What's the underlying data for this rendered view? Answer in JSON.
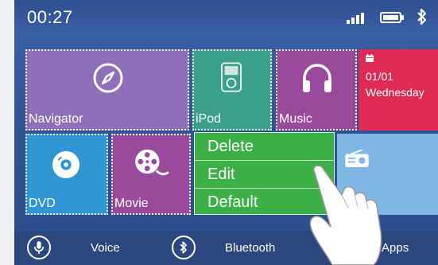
{
  "status_bar": {
    "time": "00:27",
    "icons": [
      "signal-icon",
      "battery-icon",
      "bluetooth-icon"
    ]
  },
  "tiles": {
    "navigator": {
      "label": "Navigator",
      "icon": "compass-icon",
      "color": "#8e6fb8"
    },
    "ipod": {
      "label": "iPod",
      "icon": "ipod-icon",
      "color": "#3aa089"
    },
    "music": {
      "label": "Music",
      "icon": "headphones-icon",
      "color": "#9a4a9c"
    },
    "calendar": {
      "date": "01/01",
      "day": "Wednesday",
      "icon": "calendar-icon",
      "color": "#df2a54"
    },
    "dvd": {
      "label": "DVD",
      "icon": "disc-icon",
      "color": "#2f95d3"
    },
    "movie": {
      "label": "Movie",
      "icon": "film-reel-icon",
      "color": "#9a4a9c"
    },
    "radio": {
      "icon": "radio-icon",
      "color": "#7fb6e3"
    }
  },
  "context_menu": {
    "items": [
      "Delete",
      "Edit",
      "Default"
    ],
    "color": "#3cb046"
  },
  "bottom_bar": {
    "voice_label": "Voice",
    "bluetooth_label": "Bluetooth",
    "apps_label": "Apps"
  }
}
